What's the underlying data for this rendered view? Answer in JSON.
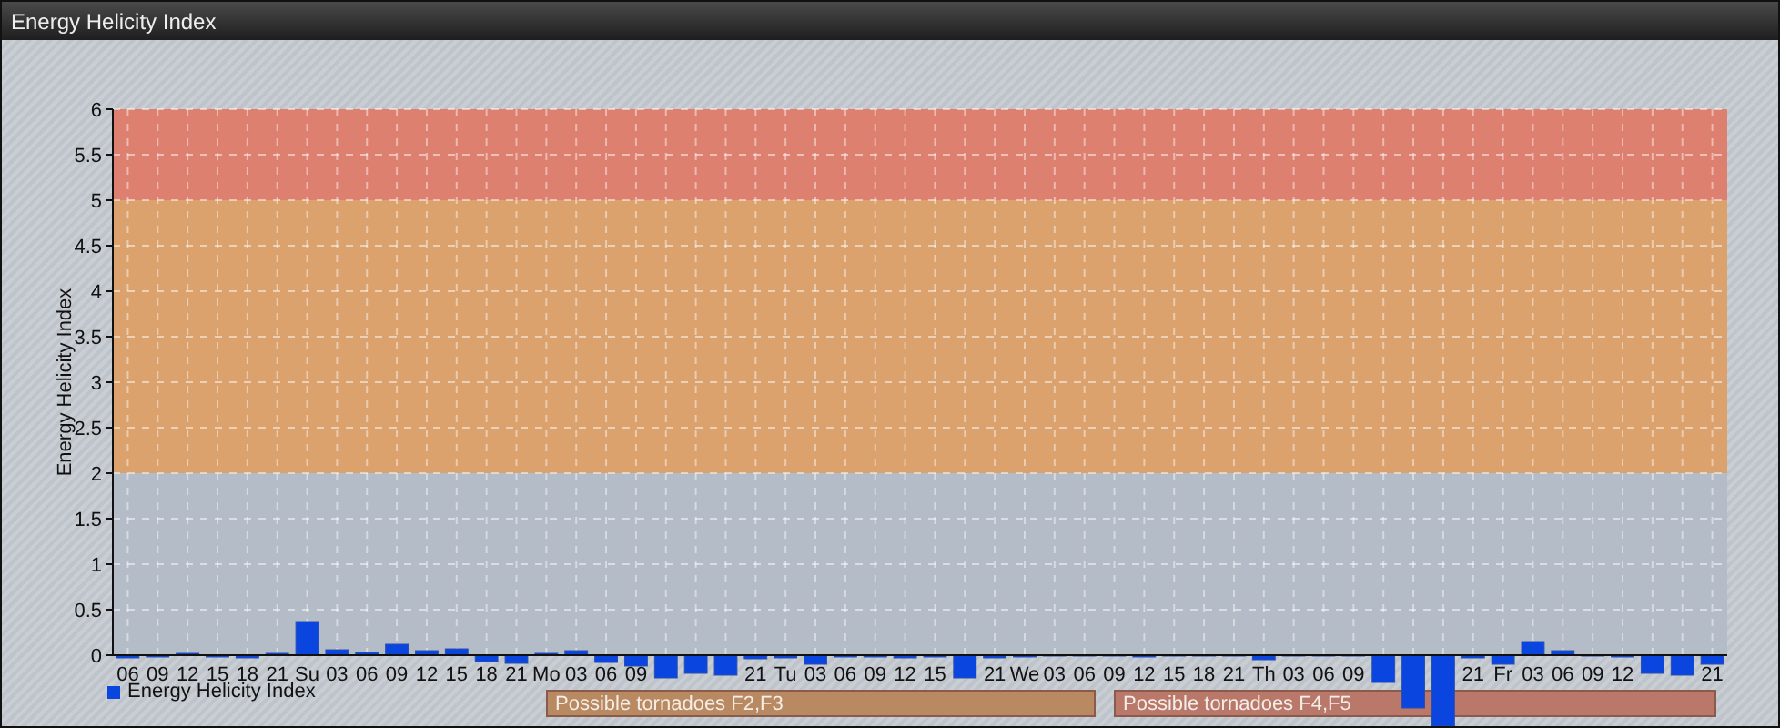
{
  "window": {
    "title": "Energy Helicity Index"
  },
  "chart": {
    "chart_data": {
      "type": "bar",
      "ylabel": "Energy Helicity Index",
      "categories": [
        "06",
        "09",
        "12",
        "15",
        "18",
        "21",
        "Su",
        "03",
        "06",
        "09",
        "12",
        "15",
        "18",
        "21",
        "Mo",
        "03",
        "06",
        "09",
        null,
        null,
        null,
        "21",
        "Tu",
        "03",
        "06",
        "09",
        "12",
        "15",
        null,
        "21",
        "We",
        "03",
        "06",
        "09",
        "12",
        "15",
        "18",
        "21",
        "Th",
        "03",
        "06",
        "09",
        null,
        null,
        null,
        "21",
        "Fr",
        "03",
        "06",
        "09",
        "12",
        null,
        null,
        "21"
      ],
      "series": [
        {
          "name": "Energy Helicity Index",
          "color": "#0a45e0",
          "values": [
            -0.03,
            -0.02,
            0.02,
            -0.02,
            -0.03,
            0.02,
            0.37,
            0.06,
            0.03,
            0.12,
            0.05,
            0.07,
            -0.07,
            -0.09,
            0.02,
            0.05,
            -0.08,
            -0.12,
            -0.25,
            -0.2,
            -0.22,
            -0.04,
            -0.03,
            -0.1,
            -0.02,
            -0.02,
            -0.03,
            -0.02,
            -0.25,
            -0.03,
            -0.02,
            -0.01,
            -0.01,
            -0.01,
            -0.02,
            -0.01,
            -0.01,
            -0.01,
            -0.05,
            -0.01,
            -0.01,
            -0.01,
            -0.3,
            -0.58,
            -0.78,
            -0.03,
            -0.1,
            0.15,
            0.05,
            -0.01,
            -0.02,
            -0.2,
            -0.22,
            -0.1
          ]
        }
      ],
      "ylim": [
        -0.8,
        6
      ],
      "yticks": [
        0,
        0.5,
        1,
        1.5,
        2,
        2.5,
        3,
        3.5,
        4,
        4.5,
        5,
        5.5,
        6
      ],
      "grid": true,
      "bands": [
        {
          "axis": "y",
          "from": 0,
          "to": 2,
          "color": "#b4bcc8"
        },
        {
          "axis": "y",
          "from": 2,
          "to": 5,
          "color": "#dba26e"
        },
        {
          "axis": "y",
          "from": 5,
          "to": 6,
          "color": "#de8070"
        }
      ]
    }
  },
  "warnings": [
    {
      "label": "Possible tornadoes F2,F3",
      "color": "#b98a62"
    },
    {
      "label": "Possible tornadoes F4,F5",
      "color": "#b9786a"
    }
  ]
}
